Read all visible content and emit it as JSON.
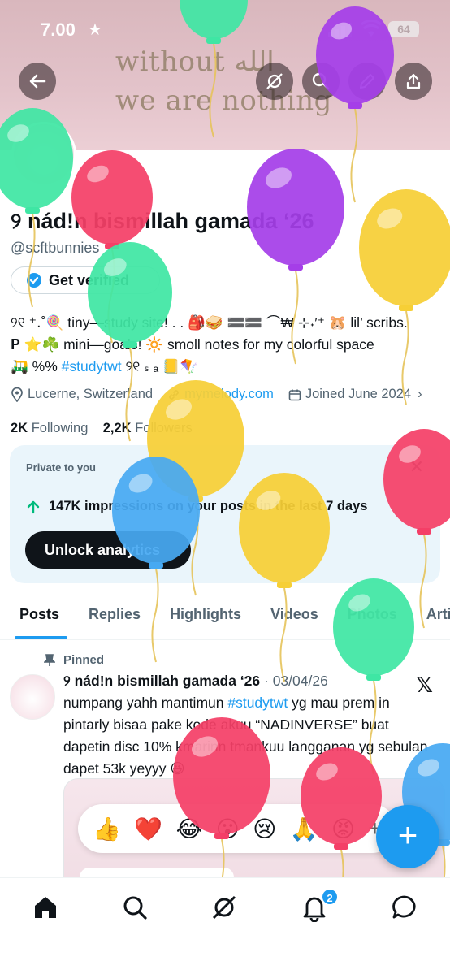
{
  "status_bar": {
    "time": "7.00",
    "battery": "64"
  },
  "banner": {
    "line1": "without الله",
    "line2": "we are nothing"
  },
  "profile": {
    "name": "୨ nád!n bismillah gamada ‘26",
    "handle": "@scftbunnies",
    "verify_label": "Get verified",
    "bio_line1": "୨୧ ⁺․˚🍭 tiny—study site! . . 🎒🥪 🟰🟰 ⌒₩ ⊹˖′⁺ 🐹 lil’ scribs.",
    "bio_line2": "𝚸 ⭐️☘️ mini—goals! 🔆 smoll notes for my colorful space",
    "bio_line3_pre": "🛺 %%",
    "bio_hashtag": "#studytwt",
    "bio_line3_post": "୨୧ ₛ ₐ 📒🪁",
    "location": "Lucerne, Switzerland",
    "website": "mymelody.com",
    "joined": "Joined June 2024",
    "following_count": "2K",
    "following_label": "Following",
    "followers_count": "2,2K",
    "followers_label": "Followers"
  },
  "analytics": {
    "private_label": "Private to you",
    "impressions_text": "147K impressions on your posts in the last 7 days",
    "unlock_label": "Unlock analytics"
  },
  "tabs": [
    "Posts",
    "Replies",
    "Highlights",
    "Videos",
    "Photos",
    "Artic"
  ],
  "post": {
    "pinned_label": "Pinned",
    "author": "୨ nád!n bismillah gamada ‘26",
    "date": "· 03/04/26",
    "text_pre": "numpang yahh mantimun ",
    "text_hashtag": "#studytwt",
    "text_post": " yg mau prem in pintarly bisaa pake kode akuu “NADINVERSE” buat dapetin disc 10% kmarinn tmankuu langganan yg sebulan dapet 53k yeyyy 😆",
    "reactions": [
      "👍",
      "❤️",
      "😂",
      "😮",
      "😢",
      "🙏",
      "😡"
    ],
    "reaction_more": "+",
    "card_code": "PROMO ID 53"
  },
  "fab_label": "+",
  "notifications_badge": "2",
  "colors": {
    "accent": "#1d9bf0",
    "text": "#0f1419",
    "muted": "#536471"
  }
}
